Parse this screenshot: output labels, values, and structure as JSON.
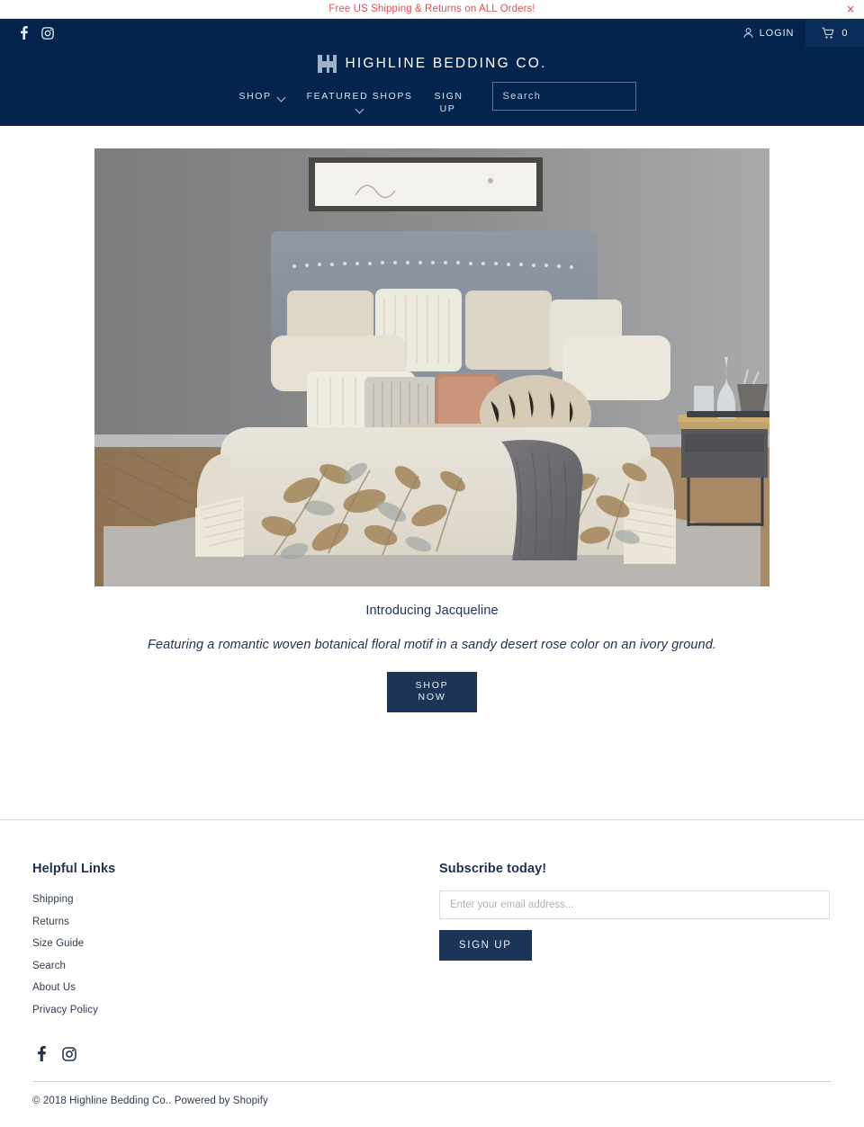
{
  "announcement": {
    "text": "Free US Shipping & Returns on ALL Orders!",
    "close_label": "×",
    "text_color": "#e24f4f"
  },
  "header": {
    "background_color": "#03254d",
    "social": [
      {
        "name": "facebook-icon",
        "label": "Facebook"
      },
      {
        "name": "instagram-icon",
        "label": "Instagram"
      }
    ],
    "login_label": "LOGIN",
    "cart_count": "0",
    "logo_text": "HIGHLINE BEDDING CO.",
    "nav": [
      {
        "label": "SHOP",
        "caret": "inline"
      },
      {
        "label": "FEATURED SHOPS",
        "caret": "below"
      },
      {
        "label": "SIGN UP",
        "caret": "none"
      }
    ],
    "search": {
      "placeholder": "Search",
      "value": "",
      "icon": "search-icon"
    }
  },
  "hero": {
    "image_alt": "Bedroom with Jacqueline botanical floral bedding, gray throw and nightstand",
    "title": "Introducing Jacqueline",
    "subtitle": "Featuring a romantic woven botanical floral motif in a sandy desert rose color on an ivory ground.",
    "button_line1": "SHOP",
    "button_line2": "NOW",
    "button_color": "#1c3556"
  },
  "footer": {
    "links_heading": "Helpful Links",
    "links": [
      "Shipping",
      "Returns",
      "Size Guide",
      "Search",
      "About Us",
      "Privacy Policy"
    ],
    "subscribe_heading": "Subscribe today!",
    "email_placeholder": "Enter your email address...",
    "email_value": "",
    "signup_label": "SIGN UP",
    "social": [
      {
        "name": "facebook-icon",
        "label": "Facebook"
      },
      {
        "name": "instagram-icon",
        "label": "Instagram"
      }
    ],
    "copyright": "© 2018 Highline Bedding Co.. Powered by Shopify"
  }
}
